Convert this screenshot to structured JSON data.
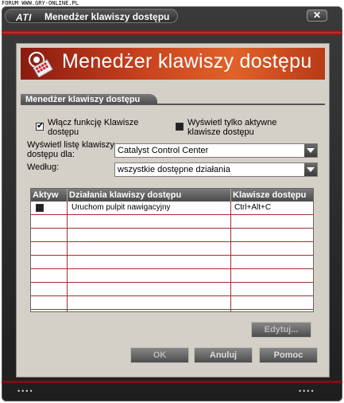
{
  "watermark": "FORUM WWW.GRY-ONLINE.PL",
  "window": {
    "logo": "ATI",
    "title": "Menedżer klawiszy dostępu",
    "close_glyph": "✕"
  },
  "banner": {
    "title": "Menedżer klawiszy dostępu",
    "icon": "hotkey-manager-icon"
  },
  "section": {
    "title": "Menedżer klawiszy dostępu"
  },
  "options": {
    "enable_label_line1": "Włącz funkcję Klawisze",
    "enable_label_line2": "dostępu",
    "enable_checked": true,
    "show_active_label_line1": "Wyświetl tylko aktywne",
    "show_active_label_line2": "klawisze dostępu",
    "show_active_checked": false
  },
  "filters": {
    "list_for_label_line1": "Wyświetl listę klawiszy",
    "list_for_label_line2": "dostępu dla:",
    "list_for_value": "Catalyst Control Center",
    "by_label": "Według:",
    "by_value": "wszystkie dostępne działania"
  },
  "table": {
    "columns": [
      "Aktyw",
      "Działania klawiszy dostępu",
      "Klawisze dostępu"
    ],
    "rows": [
      {
        "active": true,
        "action": "Uruchom pulpit nawigacyjny",
        "keys": "Ctrl+Alt+C"
      }
    ]
  },
  "buttons": {
    "edit": "Edytuj...",
    "ok": "OK",
    "cancel": "Anuluj",
    "help": "Pomoc"
  },
  "footer": {
    "left_dots": "••••",
    "right_dots": "••••"
  }
}
